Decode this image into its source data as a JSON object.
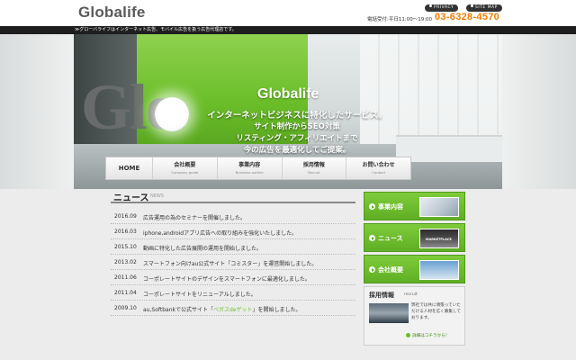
{
  "header": {
    "logo_text": "Globalife",
    "privacy_label": "PRIVACY",
    "sitemap_label": "SITE MAP",
    "phone_label": "電話受付:平日11:00〜19:00",
    "phone_number": "03-6328-4570"
  },
  "tagline": "≫グローバライフはインターネット広告、モバイル広告を扱う広告代理店です。",
  "hero": {
    "brand": "Globalife",
    "headline": "インターネットビジネスに特化したサービス。",
    "lines": [
      "サイト制作からSEO対策",
      "リスティング・アフィリエイトまで",
      "今の広告を最適化してご提案。"
    ]
  },
  "nav": {
    "items": [
      {
        "label": "HOME",
        "sub": ""
      },
      {
        "label": "会社概要",
        "sub": "Company guide"
      },
      {
        "label": "事業内容",
        "sub": "Business outline"
      },
      {
        "label": "採用情報",
        "sub": "Recruit"
      },
      {
        "label": "お問い合わせ",
        "sub": "Contact"
      }
    ]
  },
  "news": {
    "title": "ニュース",
    "title_en": "NEWS",
    "items": [
      {
        "date": "2016.09",
        "text": "広告運用の為のセミナーを開催しました。"
      },
      {
        "date": "2016.03",
        "text": "iphone,androidアプリ広告への取り組みを強化いたしました。"
      },
      {
        "date": "2015.10",
        "text": "動画に特化した広告展開の運用を開始しました。"
      },
      {
        "date": "2013.02",
        "text": "スマートフォン向けau公式サイト「コミスター」を運営開始しました。"
      },
      {
        "date": "2011.06",
        "text": "コーポレートサイトのデザインをスマートフォンに最適化しました。"
      },
      {
        "date": "2011.04",
        "text": "コーポレートサイトをリニューアルしました。"
      },
      {
        "date": "2009.10",
        "text_pre": "au,Softbankで公式サイト「",
        "text_link": "べガスdeゲット",
        "text_post": "」を開始しました。"
      }
    ]
  },
  "sidebar": {
    "banners": [
      {
        "label": "事業内容",
        "icon": "laptop-thumbnail"
      },
      {
        "label": "ニュース",
        "icon": "street-sign-thumbnail",
        "thumb_text": "MARKETPLACE"
      },
      {
        "label": "会社概要",
        "icon": "building-thumbnail"
      }
    ],
    "recruit": {
      "title": "採用情報",
      "title_en": "recruit",
      "text": "弊社では共に頑張っていただける人材を広く募集しております。",
      "link": "詳細はコチラから！"
    }
  },
  "colors": {
    "accent_green": "#6cbf2a",
    "phone_orange": "#f07c00",
    "bar_dark": "#1e1e1e"
  }
}
